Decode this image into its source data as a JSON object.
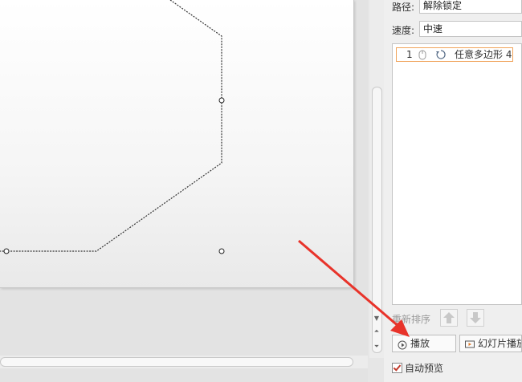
{
  "animation_pane": {
    "path_label": "路径:",
    "path_value": "解除锁定",
    "speed_label": "速度:",
    "speed_value": "中速",
    "animation_list": [
      {
        "number": "1",
        "name": "任意多边形 4"
      }
    ],
    "reorder_label": "重新排序",
    "play_button": "播放",
    "slideshow_button": "幻灯片播放",
    "autopreview_label": "自动预览",
    "autopreview_checked": true
  },
  "colors": {
    "accent_border": "#f0a35a",
    "annotation_arrow": "#e8332a"
  },
  "icons": {
    "mouse": "mouse-icon",
    "animation": "spin-animation-icon",
    "up": "move-up-icon",
    "down": "move-down-icon",
    "play": "play-icon",
    "slideshow": "slideshow-icon"
  }
}
